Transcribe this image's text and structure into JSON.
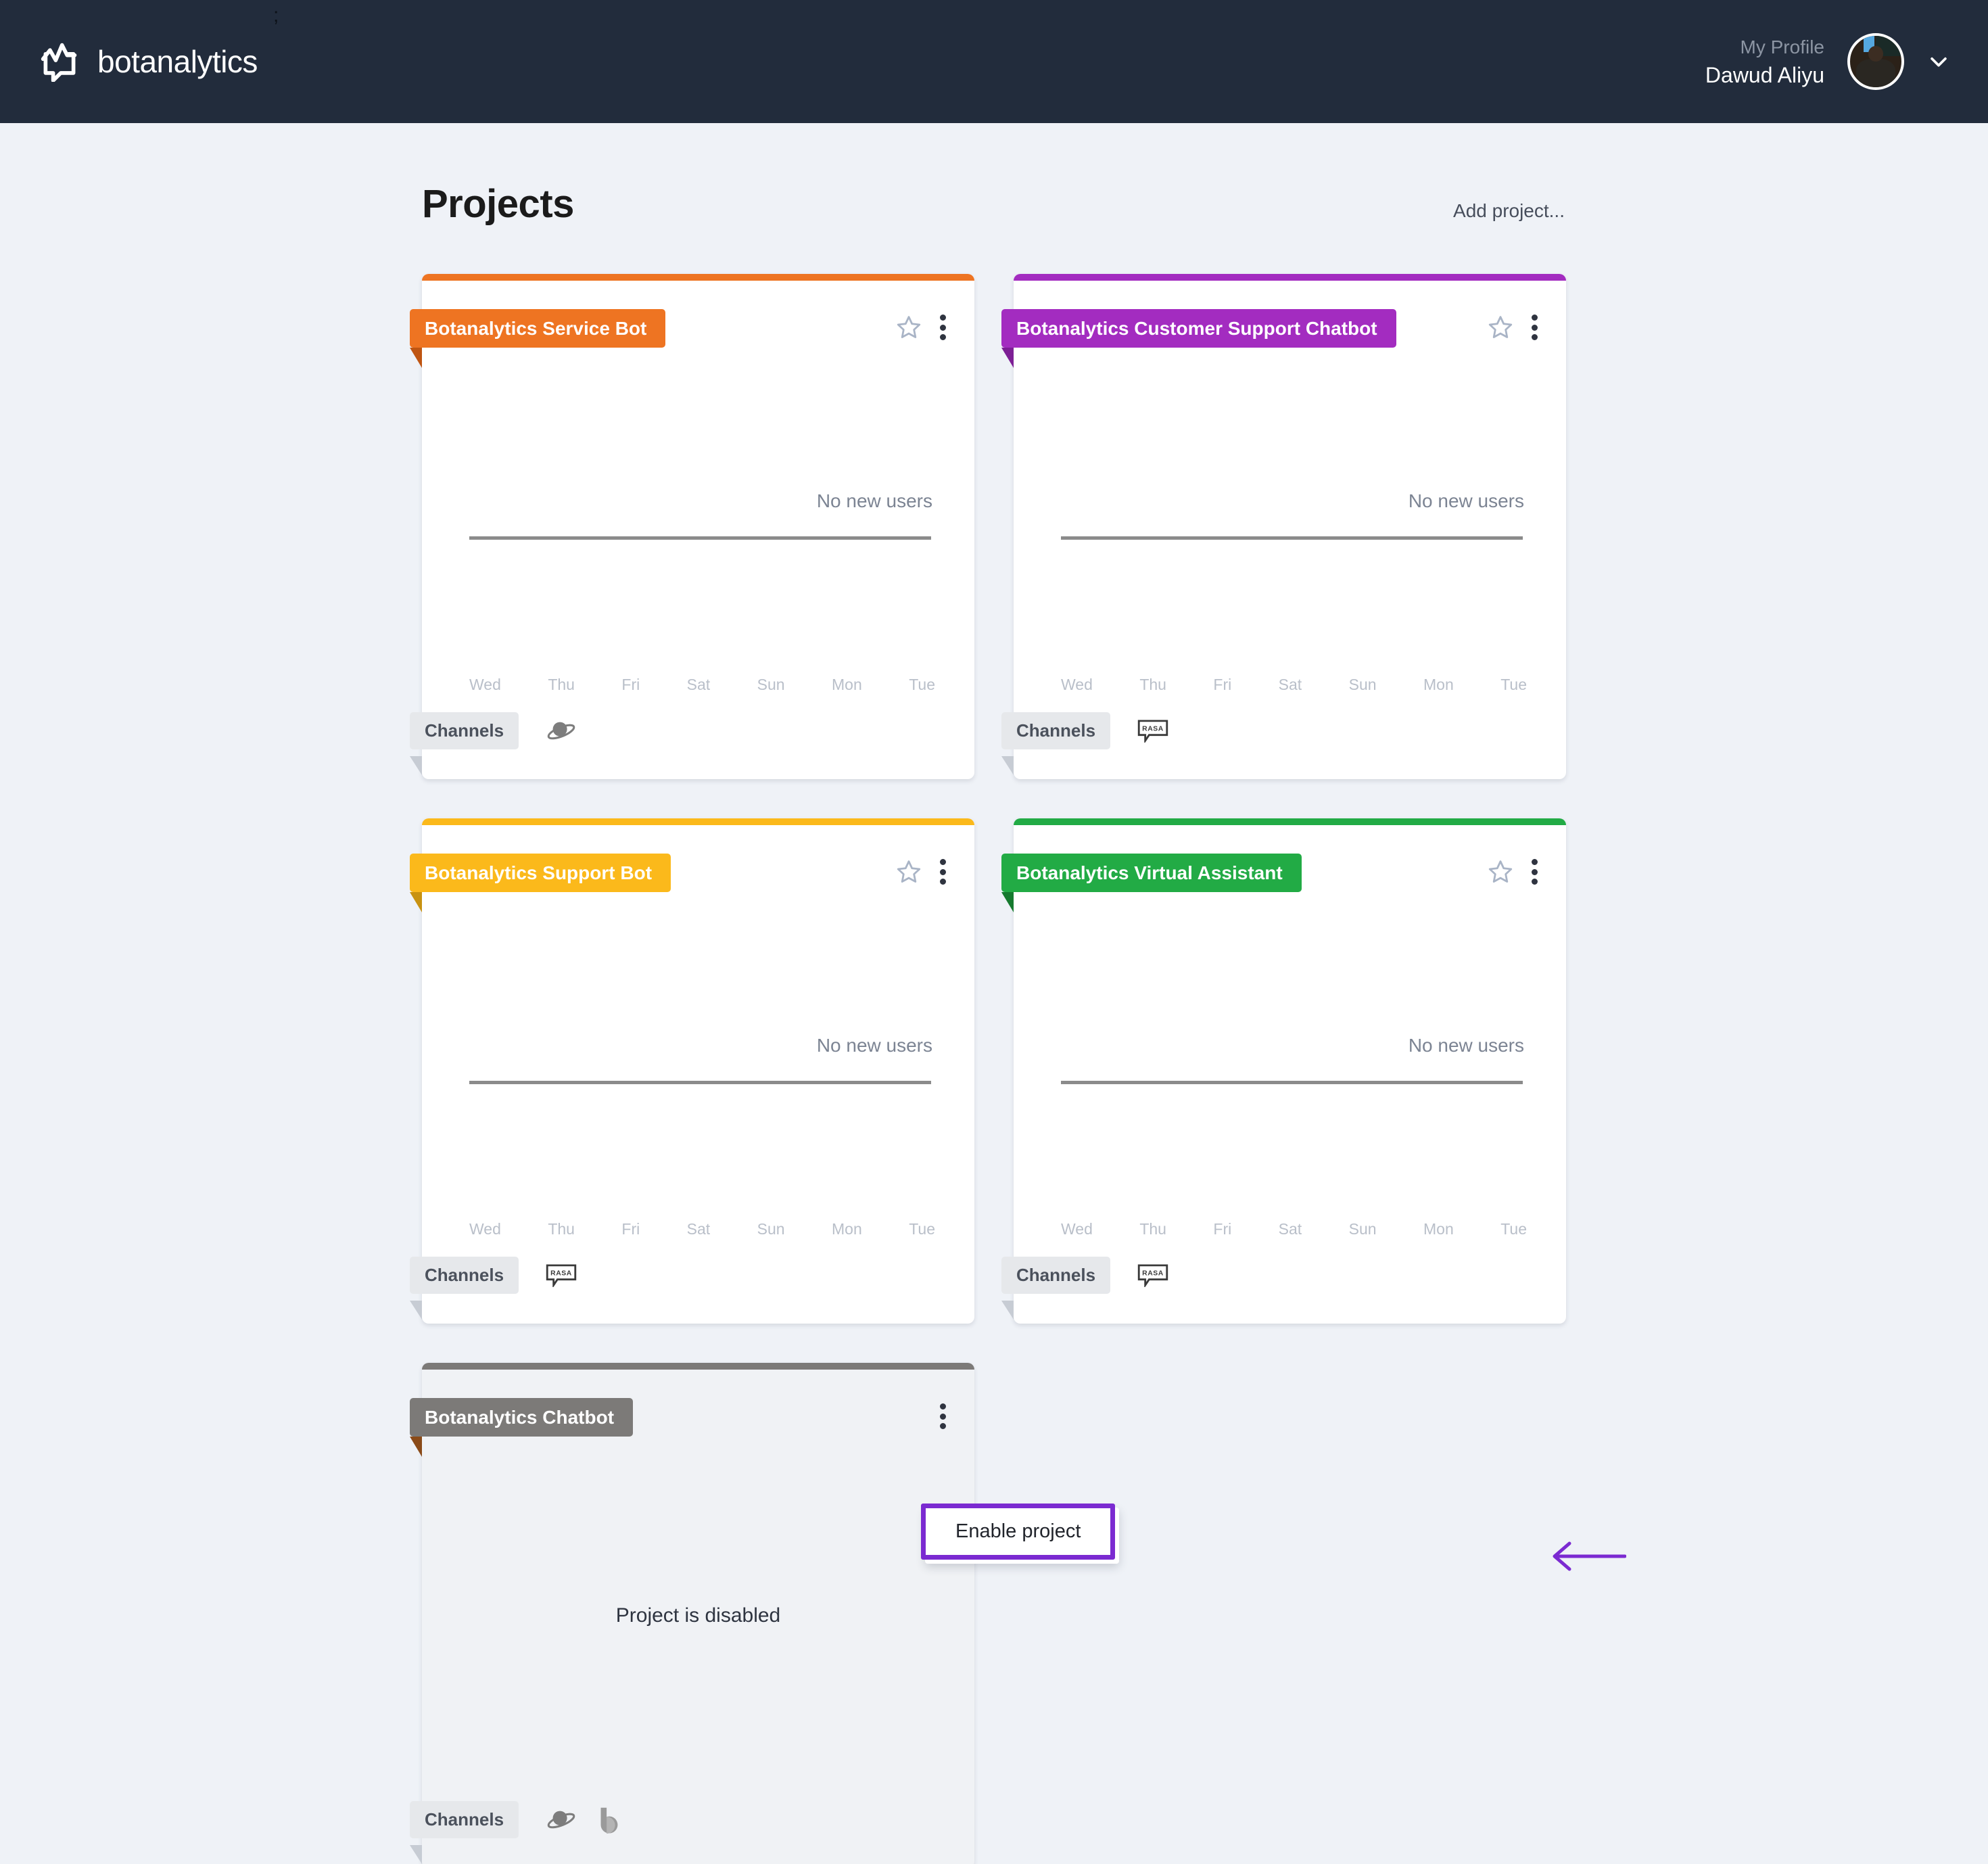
{
  "navbar": {
    "brand": "botanalytics",
    "logo_icon": "botanalytics-logo-icon",
    "artifact": ";",
    "profile_label": "My Profile",
    "profile_name": "Dawud Aliyu",
    "avatar_icon": "user-avatar",
    "chevron_icon": "chevron-down-icon"
  },
  "page": {
    "title": "Projects",
    "add_project": "Add project..."
  },
  "labels": {
    "channels": "Channels",
    "no_new_users": "No new users",
    "project_disabled": "Project is disabled"
  },
  "dropdown": {
    "enable_project": "Enable project",
    "highlight_color": "#7b2ad1",
    "arrow_icon": "left-arrow-annotation"
  },
  "chart_data": {
    "type": "line",
    "title": "No new users",
    "categories": [
      "Wed",
      "Thu",
      "Fri",
      "Sat",
      "Sun",
      "Mon",
      "Tue"
    ],
    "values": [
      0,
      0,
      0,
      0,
      0,
      0,
      0
    ],
    "xlabel": "",
    "ylabel": "",
    "ylim": [
      0,
      0
    ],
    "grid": false,
    "legend": "none",
    "annotation": "No new users",
    "series": [
      {
        "name": "New users",
        "values": [
          0,
          0,
          0,
          0,
          0,
          0,
          0
        ]
      }
    ]
  },
  "projects": [
    {
      "name": "Botanalytics Service Bot",
      "color": "#ee7422",
      "fold_color": "#bf5512",
      "status": "active",
      "starred": false,
      "star_icon": "star-outline-icon",
      "menu_icon": "kebab-menu-icon",
      "channels": [
        "dialogflow-icon"
      ],
      "chart": {
        "message": "No new users",
        "categories": [
          "Wed",
          "Thu",
          "Fri",
          "Sat",
          "Sun",
          "Mon",
          "Tue"
        ],
        "values": [
          0,
          0,
          0,
          0,
          0,
          0,
          0
        ]
      }
    },
    {
      "name": "Botanalytics Customer Support Chatbot",
      "color": "#a32cc0",
      "fold_color": "#7d1f95",
      "status": "active",
      "starred": false,
      "star_icon": "star-outline-icon",
      "menu_icon": "kebab-menu-icon",
      "channels": [
        "rasa-icon"
      ],
      "chart": {
        "message": "No new users",
        "categories": [
          "Wed",
          "Thu",
          "Fri",
          "Sat",
          "Sun",
          "Mon",
          "Tue"
        ],
        "values": [
          0,
          0,
          0,
          0,
          0,
          0,
          0
        ]
      }
    },
    {
      "name": "Botanalytics Support Bot",
      "color": "#fbb91b",
      "fold_color": "#c89211",
      "status": "active",
      "starred": false,
      "star_icon": "star-outline-icon",
      "menu_icon": "kebab-menu-icon",
      "channels": [
        "rasa-icon"
      ],
      "chart": {
        "message": "No new users",
        "categories": [
          "Wed",
          "Thu",
          "Fri",
          "Sat",
          "Sun",
          "Mon",
          "Tue"
        ],
        "values": [
          0,
          0,
          0,
          0,
          0,
          0,
          0
        ]
      }
    },
    {
      "name": "Botanalytics Virtual Assistant",
      "color": "#22ab45",
      "fold_color": "#167a2f",
      "status": "active",
      "starred": false,
      "star_icon": "star-outline-icon",
      "menu_icon": "kebab-menu-icon",
      "channels": [
        "rasa-icon"
      ],
      "chart": {
        "message": "No new users",
        "categories": [
          "Wed",
          "Thu",
          "Fri",
          "Sat",
          "Sun",
          "Mon",
          "Tue"
        ],
        "values": [
          0,
          0,
          0,
          0,
          0,
          0,
          0
        ]
      }
    },
    {
      "name": "Botanalytics Chatbot",
      "color": "#7c7a78",
      "fold_color": "#8a4a18",
      "status": "disabled",
      "status_text": "Project is disabled",
      "starred": null,
      "star_icon": null,
      "menu_icon": "kebab-menu-icon",
      "channels": [
        "dialogflow-icon",
        "botanalytics-b-icon"
      ],
      "chart": null
    }
  ]
}
